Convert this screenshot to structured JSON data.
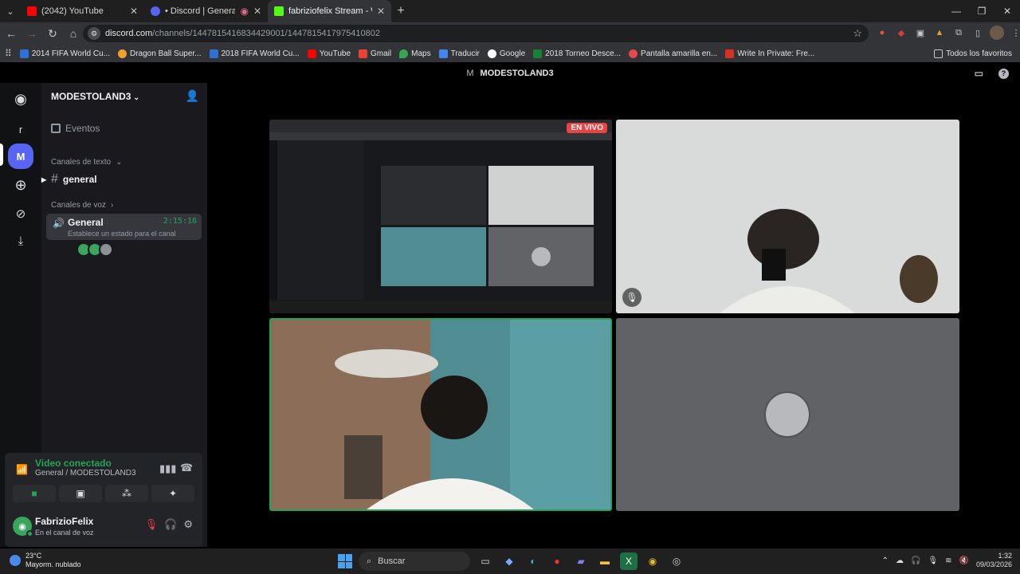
{
  "browser": {
    "tabs": [
      {
        "title": "(2042) YouTube",
        "favicon_color": "#ff0000"
      },
      {
        "title": "• Discord | General | MODE",
        "favicon_color": "#5865f2"
      },
      {
        "title": "fabriziofelix Stream - Watch Liv",
        "favicon_color": "#53fc18"
      }
    ],
    "url_host": "discord.com",
    "url_path": "/channels/1447815416834429001/1447815417975410802",
    "bookmarks": [
      {
        "label": "2014 FIFA World Cu...",
        "color": "#2f6fd6"
      },
      {
        "label": "Dragon Ball Super...",
        "color": "#f2a12c"
      },
      {
        "label": "2018 FIFA World Cu...",
        "color": "#2f6fd6"
      },
      {
        "label": "YouTube",
        "color": "#ff0000"
      },
      {
        "label": "Gmail",
        "color": "#ea4335"
      },
      {
        "label": "Maps",
        "color": "#34a853"
      },
      {
        "label": "Traducir",
        "color": "#4285f4"
      },
      {
        "label": "Google",
        "color": "#ffffff"
      },
      {
        "label": "2018 Torneo Desce...",
        "color": "#1a7f37"
      },
      {
        "label": "Pantalla amarilla en...",
        "color": "#e34b4b"
      },
      {
        "label": "Write In Private: Fre...",
        "color": "#d93025"
      }
    ],
    "all_bookmarks": "Todos los favoritos"
  },
  "discord": {
    "title_initial": "M",
    "title": "MODESTOLAND3",
    "server_name": "MODESTOLAND3",
    "rail": {
      "user_initial": "r",
      "server_initial": "M"
    },
    "events": "Eventos",
    "text_category": "Canales de texto",
    "text_channel": "general",
    "voice_category": "Canales de voz",
    "voice_channel": "General",
    "voice_timer": "2:15:16",
    "voice_status": "Establece un estado para el canal",
    "connection": {
      "status": "Video conectado",
      "location": "General / MODESTOLAND3"
    },
    "user": {
      "name": "FabrizioFelix",
      "status": "En el canal de voz"
    },
    "live_badge": "EN VIVO"
  },
  "taskbar": {
    "temperature": "23°C",
    "weather": "Mayorm. nublado",
    "search_placeholder": "Buscar",
    "time": "1:32",
    "date": "09/03/2026"
  },
  "icons": {
    "colors": {
      "discord_green": "#23a559",
      "discord_red": "#ed4245",
      "blurple": "#5865f2"
    }
  }
}
